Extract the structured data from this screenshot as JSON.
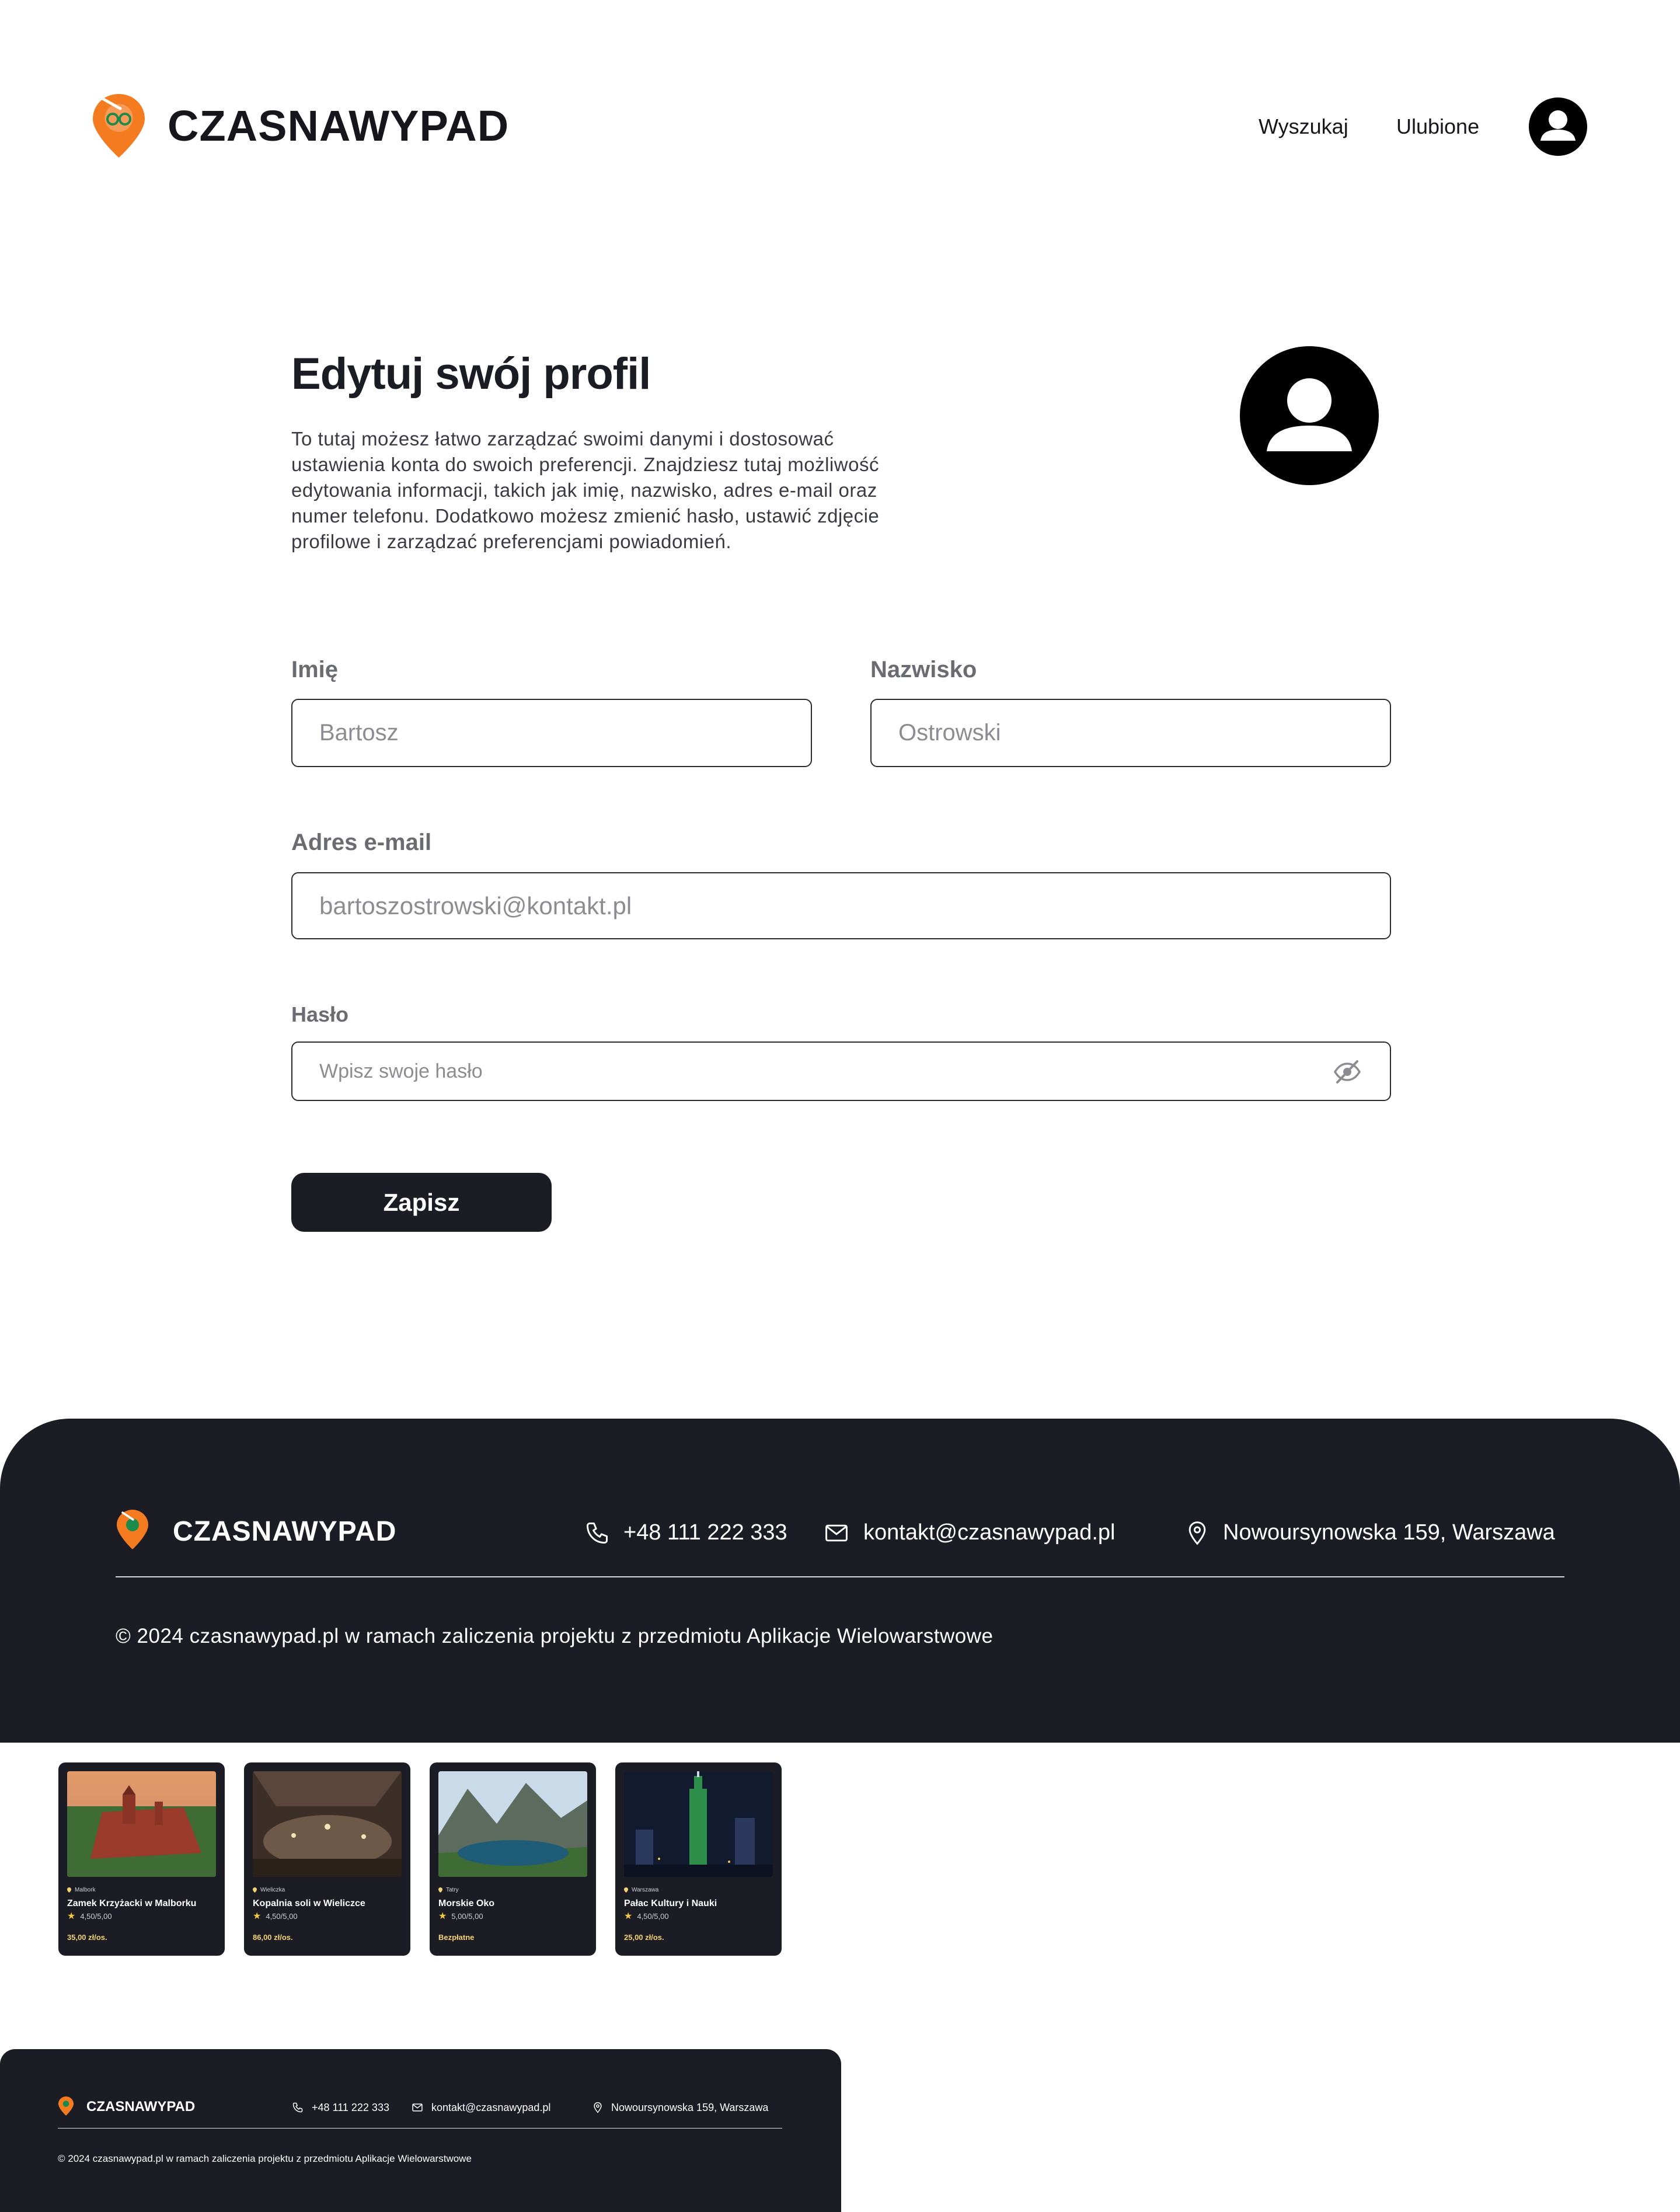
{
  "brand": {
    "name": "CZASNAWYPAD",
    "accent_color": "#f47b20",
    "dark_color": "#1c1c24"
  },
  "header": {
    "nav": [
      "Wyszukaj",
      "Ulubione"
    ],
    "avatar_icon": "user-avatar-icon"
  },
  "profile": {
    "title": "Edytuj swój profil",
    "description": "To tutaj możesz łatwo zarządzać swoimi danymi i dostosować ustawienia konta do swoich preferencji. Znajdziesz tutaj możliwość edytowania informacji, takich jak imię, nazwisko, adres e-mail oraz numer telefonu. Dodatkowo możesz zmienić hasło, ustawić zdjęcie profilowe i zarządzać preferencjami powiadomień.",
    "fields": {
      "first_name": {
        "label": "Imię",
        "value": "Bartosz"
      },
      "last_name": {
        "label": "Nazwisko",
        "value": "Ostrowski"
      },
      "email": {
        "label": "Adres e-mail",
        "value": "bartoszostrowski@kontakt.pl"
      },
      "password": {
        "label": "Hasło",
        "placeholder": "Wpisz swoje hasło"
      }
    },
    "save_label": "Zapisz"
  },
  "footer": {
    "brand": "CZASNAWYPAD",
    "phone": "+48 111 222 333",
    "email": "kontakt@czasnawypad.pl",
    "address": "Nowoursynowska 159, Warszawa",
    "copyright": "© 2024 czasnawypad.pl w ramach zaliczenia projektu z przedmiotu Aplikacje Wielowarstwowe"
  },
  "cards": [
    {
      "location": "Malbork",
      "name": "Zamek Krzyżacki w Malborku",
      "rating": "4,50/5,00",
      "price": "35,00 zł/os."
    },
    {
      "location": "Wieliczka",
      "name": "Kopalnia soli w Wieliczce",
      "rating": "4,50/5,00",
      "price": "86,00 zł/os."
    },
    {
      "location": "Tatry",
      "name": "Morskie Oko",
      "rating": "5,00/5,00",
      "price": "Bezpłatne"
    },
    {
      "location": "Warszawa",
      "name": "Pałac Kultury i Nauki",
      "rating": "4,50/5,00",
      "price": "25,00 zł/os."
    }
  ],
  "mini_footer": {
    "brand": "CZASNAWYPAD",
    "phone": "+48 111 222 333",
    "email": "kontakt@czasnawypad.pl",
    "address": "Nowoursynowska 159, Warszawa",
    "copyright": "© 2024 czasnawypad.pl w ramach zaliczenia projektu z przedmiotu Aplikacje Wielowarstwowe"
  }
}
